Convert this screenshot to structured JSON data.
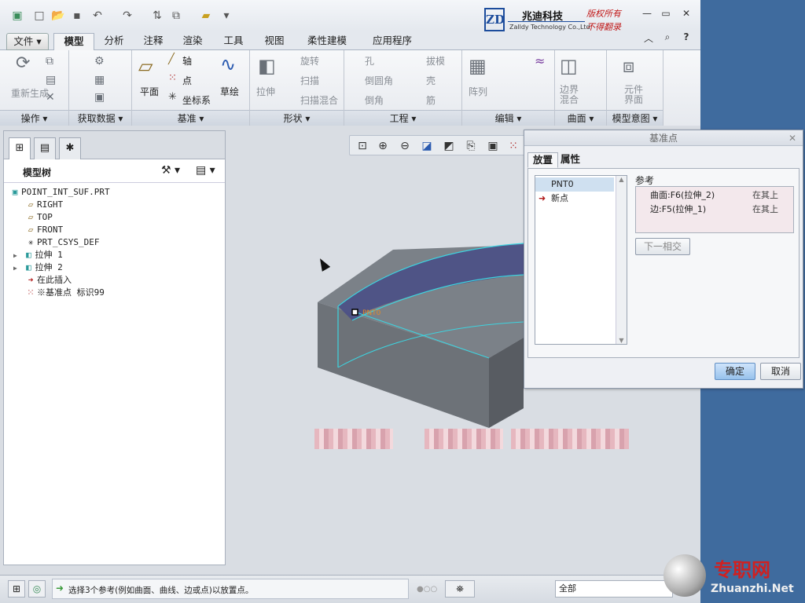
{
  "logo": {
    "mark": "ZD",
    "company_cn": "兆迪科技",
    "company_en": "Zalldy Technology Co.,Ltd.",
    "copyright1": "版权所有",
    "copyright2": "不得翻录"
  },
  "tabs": [
    "文件 ▾",
    "模型",
    "分析",
    "注释",
    "渲染",
    "工具",
    "视图",
    "柔性建模",
    "应用程序"
  ],
  "ribbon": {
    "regen": "重新生成",
    "datum_items": {
      "plane": "平面",
      "axis": "轴",
      "point": "点",
      "csys": "坐标系",
      "sketch": "草绘"
    },
    "shape": {
      "extrude": "拉伸",
      "revolve": "旋转",
      "sweep": "扫描",
      "swept_blend": "扫描混合"
    },
    "eng": {
      "hole": "孔",
      "round": "倒圆角",
      "chamfer": "倒角",
      "draft": "拔模",
      "shell": "壳",
      "rib": "筋"
    },
    "edit": {
      "pattern": "阵列"
    },
    "surface": {
      "boundary_blend": "边界混合"
    },
    "model_intent": {
      "component_interface": "元件界面"
    },
    "groups": [
      "操作 ▾",
      "获取数据 ▾",
      "基准 ▾",
      "形状 ▾",
      "工程 ▾",
      "编辑 ▾",
      "曲面 ▾",
      "模型意图 ▾"
    ]
  },
  "model_tree": {
    "title": "模型树",
    "items": [
      "POINT_INT_SUF.PRT",
      "RIGHT",
      "TOP",
      "FRONT",
      "PRT_CSYS_DEF",
      "拉伸 1",
      "拉伸 2",
      "在此插入",
      "※基准点 标识99"
    ]
  },
  "viewport": {
    "point_label": "PNT0"
  },
  "dialog": {
    "title": "基准点",
    "tabs": [
      "放置",
      "属性"
    ],
    "points": [
      "PNT0",
      "新点"
    ],
    "refs_label": "参考",
    "refs": [
      {
        "ref": "曲面:F6(拉伸_2)",
        "constraint": "在其上"
      },
      {
        "ref": "边:F5(拉伸_1)",
        "constraint": "在其上"
      }
    ],
    "next_intersection": "下一相交",
    "ok": "确定",
    "cancel": "取消"
  },
  "status": {
    "message": "选择3个参考(例如曲面、曲线、边或点)以放置点。",
    "filter": "全部"
  },
  "watermark": {
    "cn": "专职网",
    "url": "Zhuanzhi.Net"
  }
}
